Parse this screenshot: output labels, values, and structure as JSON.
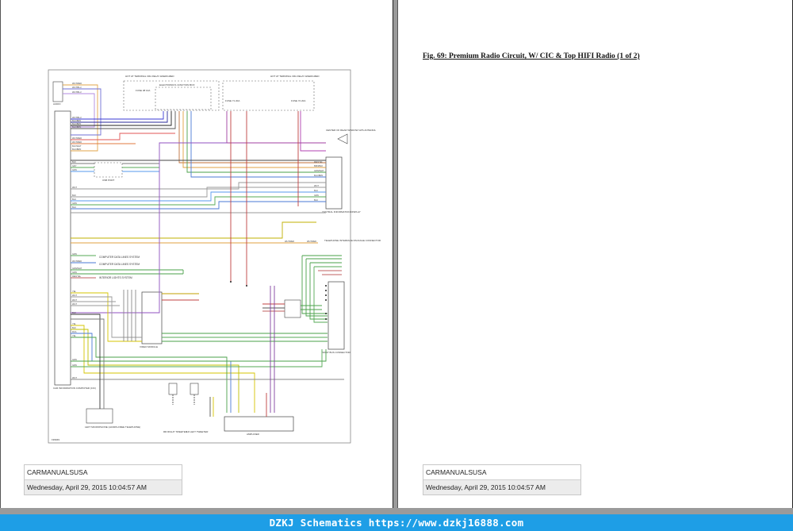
{
  "right_page": {
    "figure_title": "Fig. 69: Premium Radio Circuit, W/ CIC & Top HIFI Radio (1 of 2)"
  },
  "footer": {
    "company": "CARMANUALSUSA",
    "timestamp": "Wednesday, April 29, 2015 10:04:57 AM"
  },
  "watermark": {
    "text": "DZKJ Schematics https://www.dzkj16888.com"
  },
  "diagram": {
    "labels": {
      "hot_battery": "HOT AT TERMINAL 30G RELAY ENERGIZED",
      "hot_battery2": "HOT AT TERMINAL 30G RELAY ENERGIZED",
      "junction_box": "ELECTRONICS JUNCTION BOX",
      "audio_unit": "AUDIO (HEAD) UNIT",
      "usb_port": "USB PORT",
      "central_info": "CENTRAL INFORMATION DISPLAY",
      "video_module": "VIDEO MODULE",
      "cic": "CAR INFORMATION COMPUTER (CIC)",
      "amp": "AMPLIFIER",
      "most_bus": "MOST BUS CONNECTOR",
      "mic": "LEFT MICROPHONE (HANDS-FREE TELEPHONE)",
      "telephone": "TELEPHONE INTERFACE PACKAGE CONNECTOR",
      "antenna": "CENTER OF REAR WINDOW GPS ANTENNA",
      "rr_tweeter": "RR RIGHT TWEETER",
      "lr_tweeter": "LR LEFT TWEETER",
      "diagram_id": "199949",
      "computer_data": "COMPUTER DATA LINES SYSTEM",
      "computer_data2": "COMPUTER DATA LINES SYSTEM",
      "interior_lights": "INTERIOR LIGHTS SYSTEM",
      "fuse1": "FUSE 38 10A",
      "fuse2": "FUSE 71 20A",
      "fuse3": "FUSE 72 20A",
      "grounds": "GROUND DISTRIBUTION"
    }
  }
}
